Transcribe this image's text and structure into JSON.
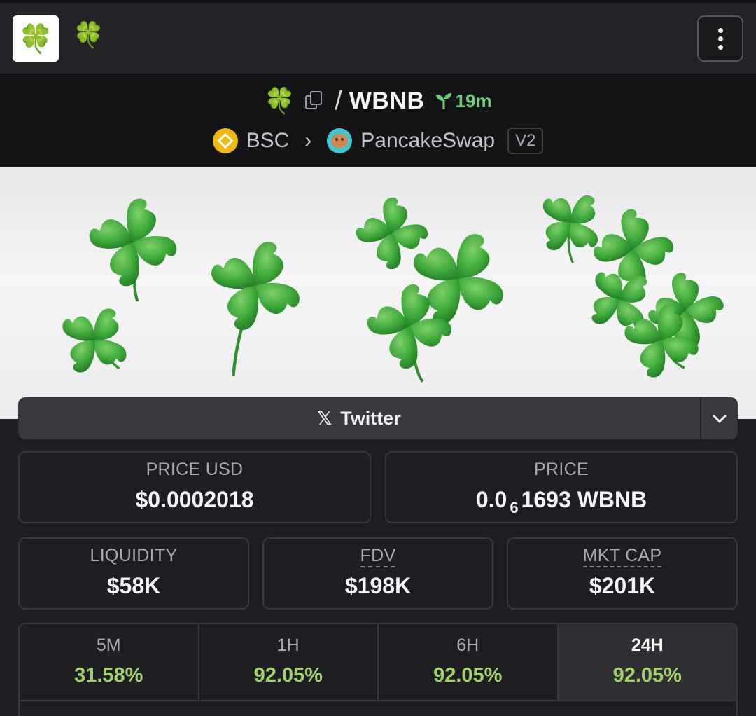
{
  "topbar": {
    "logo_emoji": "🍀",
    "token_emoji": "🍀"
  },
  "pair": {
    "base_emoji": "🍀",
    "separator": "/",
    "quote": "WBNB",
    "age": "19m",
    "chain": "BSC",
    "dex": "PancakeSwap",
    "version": "V2"
  },
  "links": {
    "twitter_label": "Twitter",
    "x_glyph": "𝕏"
  },
  "stats": {
    "price_usd_label": "PRICE USD",
    "price_usd": "$0.0002018",
    "price_label": "PRICE",
    "price_prefix": "0.0",
    "price_zeros": "6",
    "price_suffix": "1693 WBNB",
    "liquidity_label": "LIQUIDITY",
    "liquidity": "$58K",
    "fdv_label": "FDV",
    "fdv": "$198K",
    "mcap_label": "MKT CAP",
    "mcap": "$201K"
  },
  "timeframes": [
    {
      "label": "5M",
      "change": "31.58%"
    },
    {
      "label": "1H",
      "change": "92.05%"
    },
    {
      "label": "6H",
      "change": "92.05%"
    },
    {
      "label": "24H",
      "change": "92.05%"
    }
  ],
  "colors": {
    "positive": "#9fd468",
    "age_green": "#6fd07c",
    "clover_green": "#3aa335"
  }
}
